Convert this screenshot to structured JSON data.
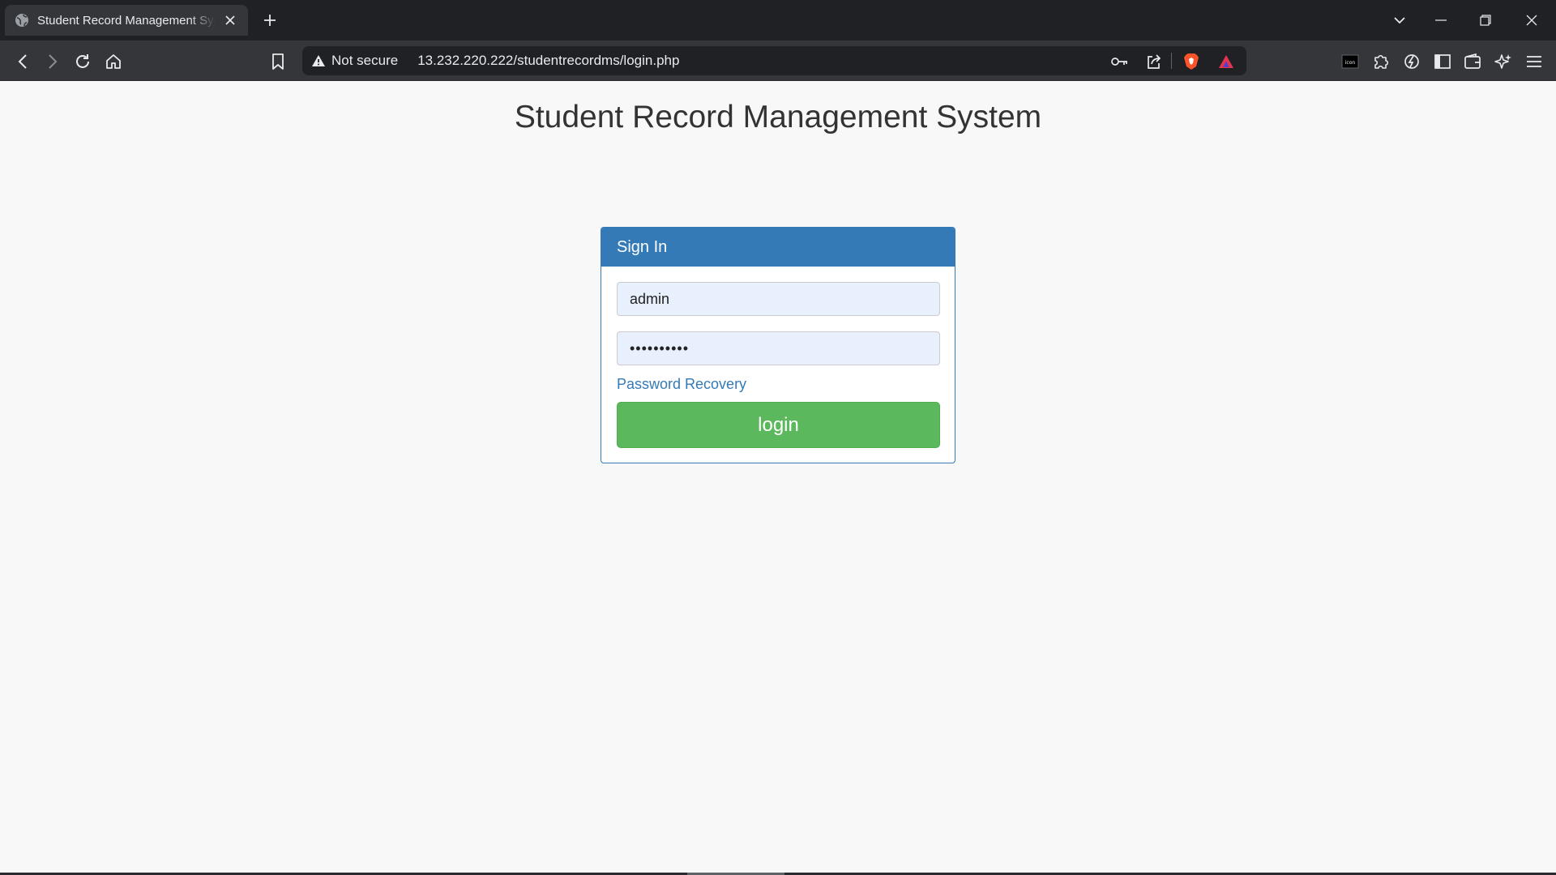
{
  "browser": {
    "tab": {
      "title": "Student Record Management System",
      "favicon": "globe-icon"
    },
    "toolbar": {
      "security_label": "Not secure",
      "url": "13.232.220.222/studentrecordms/login.php"
    },
    "icons": [
      "back-icon",
      "forward-icon",
      "reload-icon",
      "home-icon",
      "bookmark-icon",
      "warning-icon",
      "key-icon",
      "share-icon",
      "brave-shield-icon",
      "brave-rewards-icon",
      "extension-icon",
      "puzzle-icon",
      "speedreader-icon",
      "sidebar-icon",
      "wallet-icon",
      "leo-icon",
      "menu-icon",
      "tab-search-icon",
      "minimize-icon",
      "restore-icon",
      "close-icon"
    ],
    "colors": {
      "frame": "#202124",
      "toolbar": "#35363a"
    }
  },
  "page": {
    "title": "Student Record Management System",
    "panel": {
      "heading": "Sign In",
      "username_value": "admin",
      "password_value": "••••••••••",
      "recovery_link": "Password Recovery",
      "login_button": "login"
    },
    "colors": {
      "primary": "#337ab7",
      "success": "#5cb85c",
      "background": "#f8f8f8",
      "autofill": "#e8f0fe"
    }
  }
}
